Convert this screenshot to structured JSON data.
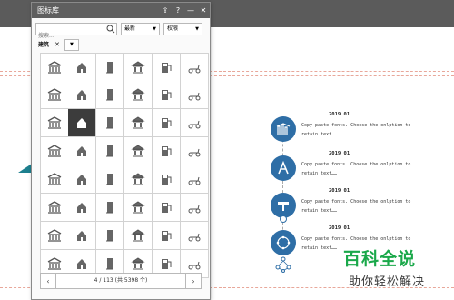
{
  "panel": {
    "title": "图标库",
    "controls": {
      "pin": "⇪",
      "help": "?",
      "minimize": "—",
      "close": "✕"
    },
    "search": {
      "placeholder": "搜索..."
    },
    "sort": {
      "selected": "最新"
    },
    "license": {
      "selected": "权限"
    },
    "filter_tag": {
      "label": "建筑",
      "remove": "✕"
    },
    "pagination": {
      "prev": "‹",
      "next": "›",
      "info": "4 / 113 (共 5398 个)"
    },
    "icons": [
      "bank-icon",
      "hand-house-icon",
      "pillar-icon",
      "temple-icon",
      "gas-station-icon",
      "scooter-icon",
      "house-search-icon",
      "office-buildings-icon",
      "barn-icon",
      "cottage-icon",
      "home-outline-icon",
      "archive-building-icon",
      "crane-icon",
      "sign-icon",
      "factory-icon",
      "school-building-icon",
      "town-hall-icon",
      "hangar-icon",
      "skyscraper-icon",
      "trees-icon",
      "tower-block-icon",
      "gazebo-icon",
      "capitol-icon",
      "warehouse-icon",
      "museum-icon",
      "chimney-factory-icon",
      "sofa-icon",
      "gate-icon",
      "cabinet-icon",
      "bench-icon",
      "mall-icon",
      "loudspeaker-tower-icon",
      "brick-wall-icon",
      "arch-door-icon",
      "arched-window-icon",
      "window-frame-icon",
      "shop-front-icon",
      "hydrant-icon",
      "cart-shop-icon",
      "fence-icon",
      "church-window-icon",
      "picture-frame-icon",
      "cooking-pot-icon",
      "stove-icon",
      "tent-icon",
      "shelves-icon",
      "printer-icon",
      "desk-icon"
    ],
    "selected_icon_index": 13
  },
  "slide": {
    "timeline": [
      {
        "year": "2019 01",
        "text": "Copy paste fonts. Choose the onlption to retain text……",
        "icon": "building-crane-icon"
      },
      {
        "year": "2019 01",
        "text": "Copy paste fonts. Choose the onlption to retain text……",
        "icon": "letter-a-icon"
      },
      {
        "year": "2019 01",
        "text": "Copy paste fonts. Choose the onlption to retain text……",
        "icon": "pipe-tool-icon"
      },
      {
        "year": "2019 01",
        "text": "Copy paste fonts. Choose the onlption to retain text……",
        "icon": "ring-network-icon"
      }
    ],
    "colors": {
      "accent": "#2e6ea6",
      "teal": "#1d7f8e",
      "watermark": "#1aa84a"
    }
  },
  "watermark": {
    "main": "百科全说",
    "sub": "助你轻松解决"
  }
}
